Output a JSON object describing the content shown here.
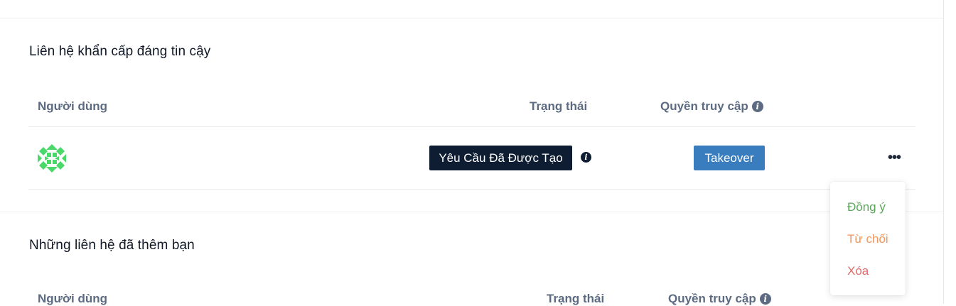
{
  "trusted_section": {
    "title": "Liên hệ khẩn cấp đáng tin cậy",
    "columns": {
      "user": "Người dùng",
      "status": "Trạng thái",
      "access": "Quyền truy cập"
    },
    "row": {
      "status_badge": "Yêu Cầu Đã Được Tạo",
      "takeover_label": "Takeover",
      "more_label": "•••"
    }
  },
  "dropdown": {
    "items": [
      {
        "label": "Đồng ý",
        "color": "#5aa65a"
      },
      {
        "label": "Từ chối",
        "color": "#f0965a"
      },
      {
        "label": "Xóa",
        "color": "#e26a6a"
      }
    ]
  },
  "added_section": {
    "title": "Những liên hệ đã thêm bạn",
    "columns": {
      "user": "Người dùng",
      "status": "Trạng thái",
      "access": "Quyền truy cập"
    }
  },
  "info_icon_glyph": "i",
  "colors": {
    "header_text": "#5c6b82",
    "badge_bg": "#0f1d33",
    "takeover_bg": "#3a7dbf",
    "avatar_green": "#4ad86a"
  }
}
